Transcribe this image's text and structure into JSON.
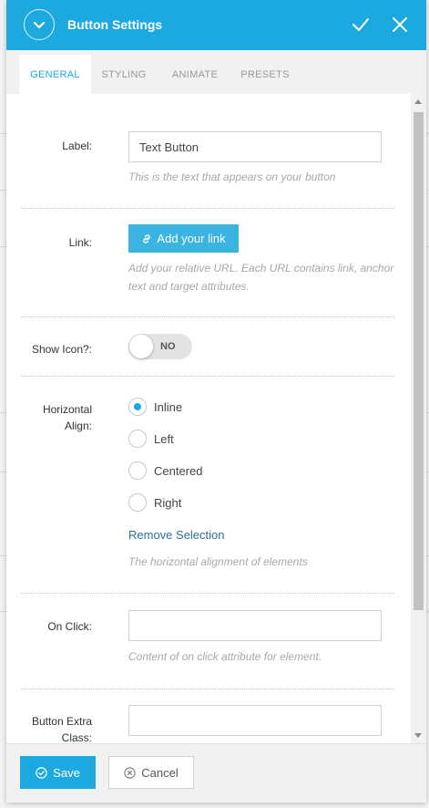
{
  "header": {
    "title": "Button Settings",
    "color": "#1ca9df"
  },
  "tabs": [
    {
      "label": "GENERAL",
      "active": true
    },
    {
      "label": "STYLING",
      "active": false
    },
    {
      "label": "ANIMATE",
      "active": false
    },
    {
      "label": "PRESETS",
      "active": false
    }
  ],
  "fields": {
    "label": {
      "label": "Label:",
      "value": "Text Button",
      "help": "This is the text that appears on your button"
    },
    "link": {
      "label": "Link:",
      "button": "Add your link",
      "help": "Add your relative URL. Each URL contains link, anchor text and target attributes."
    },
    "show_icon": {
      "label": "Show Icon?:",
      "state": "NO"
    },
    "horizontal_align": {
      "label": "Horizontal Align:",
      "options": [
        "Inline",
        "Left",
        "Centered",
        "Right"
      ],
      "selected": "Inline",
      "remove": "Remove Selection",
      "help": "The horizontal alignment of elements"
    },
    "on_click": {
      "label": "On Click:",
      "value": "",
      "help": "Content of on click attribute for element."
    },
    "extra_class": {
      "label": "Button Extra Class:",
      "value": ""
    }
  },
  "footer": {
    "save": "Save",
    "cancel": "Cancel"
  }
}
